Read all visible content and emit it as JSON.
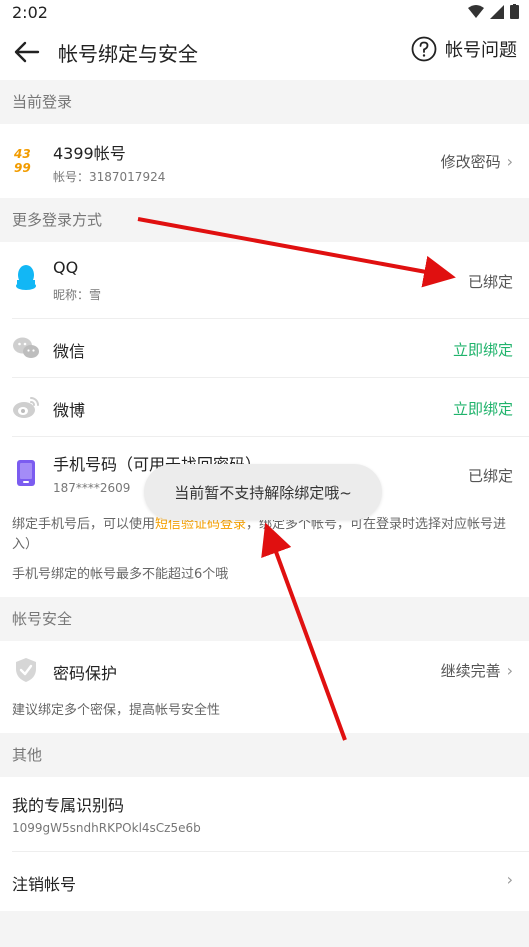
{
  "status_bar": {
    "time": "2:02"
  },
  "app_bar": {
    "title": "帐号绑定与安全",
    "help_label": "帐号问题"
  },
  "current_login": {
    "header": "当前登录",
    "logo_text": "43\n99",
    "name": "4399帐号",
    "account": "帐号：3187017924",
    "action": "修改密码"
  },
  "more_login": {
    "header": "更多登录方式",
    "qq": {
      "name": "QQ",
      "nickname": "昵称：雪",
      "status": "已绑定"
    },
    "wechat": {
      "name": "微信",
      "action": "立即绑定"
    },
    "weibo": {
      "name": "微博",
      "action": "立即绑定"
    },
    "phone": {
      "name": "手机号码（可用于找回密码）",
      "number": "187****2609",
      "status": "已绑定"
    },
    "note_prefix": "绑定手机号后，可以使用",
    "note_link": "短信验证码登录",
    "note_suffix": "，绑定多个帐号，可在登录时选择对应帐号进入）",
    "note_line2": "手机号绑定的帐号最多不能超过6个哦"
  },
  "toast": "当前暂不支持解除绑定哦~",
  "account_security": {
    "header": "帐号安全",
    "password_protect": {
      "name": "密码保护",
      "action": "继续完善"
    },
    "note": "建议绑定多个密保，提高帐号安全性"
  },
  "other": {
    "header": "其他",
    "id_code": {
      "label": "我的专属识别码",
      "value": "1099gW5sndhRKPOkl4sCz5e6b"
    },
    "cancel_account": {
      "label": "注销帐号"
    }
  },
  "colors": {
    "accent_green": "#1fb36b",
    "link_orange": "#f5a000",
    "arrow_red": "#e01010"
  }
}
